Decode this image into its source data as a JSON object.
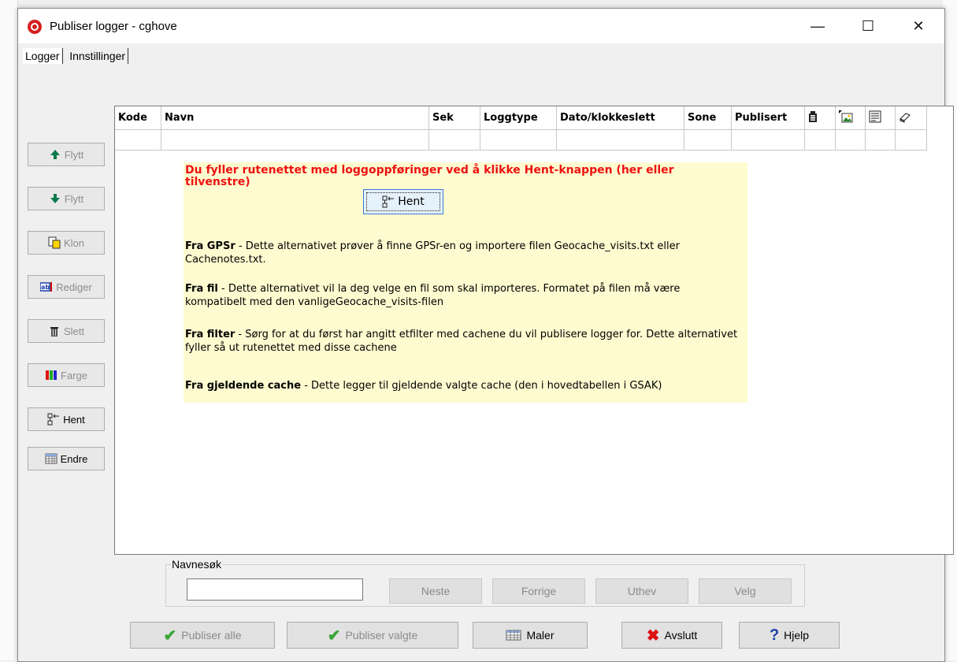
{
  "window": {
    "title": "Publiser logger - cghove"
  },
  "controls": {
    "minimize": "—",
    "maximize": "☐",
    "close": "✕"
  },
  "tabs": [
    "Logger",
    "Innstillinger"
  ],
  "sidebar": {
    "items": [
      {
        "label": "Flytt",
        "icon": "arrow-up-icon",
        "enabled": false
      },
      {
        "label": "Flytt",
        "icon": "arrow-down-icon",
        "enabled": false
      },
      {
        "label": "Klon",
        "icon": "clone-icon",
        "enabled": false
      },
      {
        "label": "Rediger",
        "icon": "edit-icon",
        "enabled": false
      },
      {
        "label": "Slett",
        "icon": "trash-icon",
        "enabled": false
      },
      {
        "label": "Farge",
        "icon": "color-icon",
        "enabled": false
      },
      {
        "label": "Hent",
        "icon": "fetch-icon",
        "enabled": true
      },
      {
        "label": "Endre",
        "icon": "grid-icon",
        "enabled": true
      }
    ]
  },
  "grid": {
    "columns": [
      "Kode",
      "Navn",
      "Sek",
      "Loggtype",
      "Dato/klokkeslett",
      "Sone",
      "Publisert",
      "",
      "",
      "",
      ""
    ],
    "rows": [
      [
        "",
        "",
        "",
        "",
        "",
        "",
        "",
        "",
        "",
        "",
        ""
      ]
    ]
  },
  "info": {
    "headline": "Du fyller rutenettet med loggoppføringer ved å klikke Hent-knappen (her eller tilvenstre)",
    "hent_label": "Hent",
    "paragraphs": [
      {
        "title": "Fra GPSr",
        "text": " - Dette alternativet prøver å finne GPSr-en og importere filen Geocache_visits.txt eller Cachenotes.txt."
      },
      {
        "title": "Fra fil",
        "text": " - Dette alternativet vil la deg velge en fil som skal importeres. Formatet på filen må være kompatibelt med den vanligeGeocache_visits-filen"
      },
      {
        "title": "Fra filter",
        "text": " - Sørg for at du først har angitt etfilter med cachene du vil publisere logger for. Dette alternativet fyller så ut rutenettet med disse cachene"
      },
      {
        "title": "Fra gjeldende cache",
        "text": " - Dette legger til gjeldende valgte cache (den i hovedtabellen i GSAK)"
      }
    ]
  },
  "search": {
    "legend": "Navnesøk",
    "value": "",
    "buttons": [
      "Neste",
      "Forrige",
      "Uthev",
      "Velg"
    ]
  },
  "bottom": {
    "buttons": [
      {
        "label": "Publiser alle",
        "enabled": false
      },
      {
        "label": "Publiser valgte",
        "enabled": false
      },
      {
        "label": "Maler",
        "enabled": true
      },
      {
        "label": "Avslutt",
        "enabled": true
      },
      {
        "label": "Hjelp",
        "enabled": true
      }
    ]
  },
  "colors": {
    "info_bg": "#fffbd0",
    "headline": "#ee1111",
    "accent_border": "#3b79d3"
  }
}
